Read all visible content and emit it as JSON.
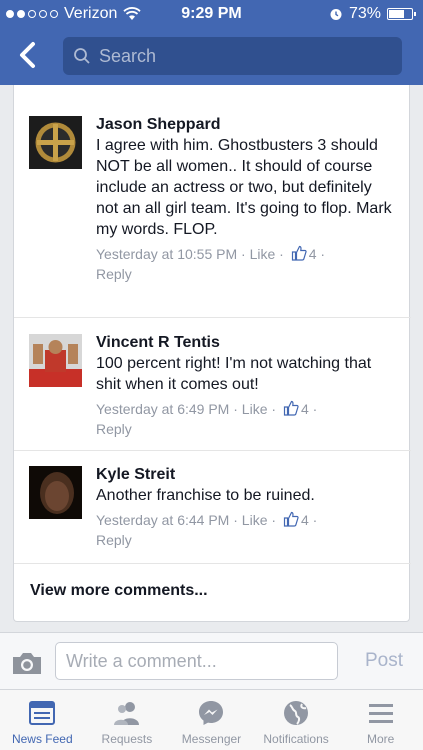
{
  "status_bar": {
    "carrier": "Verizon",
    "time": "9:29 PM",
    "battery": "73%",
    "battery_level": 0.73
  },
  "nav": {
    "search_placeholder": "Search"
  },
  "comments": [
    {
      "name": "Jason Sheppard",
      "text": "I agree with him. Ghostbusters 3 should NOT be all women.. It should of course include an actress or two, but definitely not an all girl team. It's going to flop. Mark my words. FLOP.",
      "time": "Yesterday at 10:55 PM",
      "like_label": "Like",
      "like_count": "4",
      "reply_label": "Reply"
    },
    {
      "name": "Vincent R Tentis",
      "text": "100 percent right! I'm not watching that shit when it comes out!",
      "time": "Yesterday at 6:49 PM",
      "like_label": "Like",
      "like_count": "4",
      "reply_label": "Reply"
    },
    {
      "name": "Kyle Streit",
      "text": "Another franchise to be ruined.",
      "time": "Yesterday at 6:44 PM",
      "like_label": "Like",
      "like_count": "4",
      "reply_label": "Reply"
    }
  ],
  "view_more": "View more comments...",
  "composer": {
    "placeholder": "Write a comment...",
    "post_label": "Post"
  },
  "tabs": [
    {
      "label": "News Feed",
      "icon": "news-feed-icon",
      "active": true
    },
    {
      "label": "Requests",
      "icon": "friend-requests-icon",
      "active": false
    },
    {
      "label": "Messenger",
      "icon": "messenger-icon",
      "active": false
    },
    {
      "label": "Notifications",
      "icon": "globe-icon",
      "active": false
    },
    {
      "label": "More",
      "icon": "menu-icon",
      "active": false
    }
  ],
  "colors": {
    "brand": "#4267b2",
    "meta": "#9197a3"
  }
}
